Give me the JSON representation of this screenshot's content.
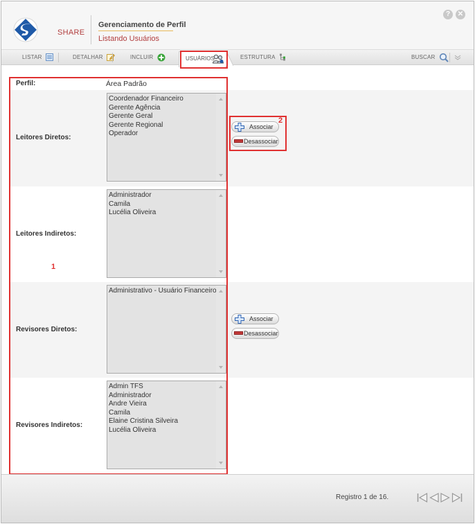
{
  "header": {
    "brand": "SHARE",
    "title": "Gerenciamento de Perfil",
    "subtitle": "Listando Usuários",
    "help_glyph": "?",
    "close_glyph": "✕"
  },
  "toolbar": {
    "listar": "LISTAR",
    "detalhar": "DETALHAR",
    "incluir": "INCLUIR",
    "usuarios": "USUÁRIOS",
    "estrutura": "ESTRUTURA",
    "buscar": "BUSCAR"
  },
  "form": {
    "perfil_label": "Perfil:",
    "perfil_value": "Área Padrão",
    "leitores_diretos": {
      "label": "Leitores Diretos:",
      "items": [
        "Coordenador Financeiro",
        "Gerente Agência",
        "Gerente Geral",
        "Gerente Regional",
        "Operador"
      ]
    },
    "leitores_indiretos": {
      "label": "Leitores Indiretos:",
      "items": [
        "Administrador",
        "Camila",
        "Lucélia Oliveira"
      ]
    },
    "revisores_diretos": {
      "label": "Revisores Diretos:",
      "items": [
        "Administrativo - Usuário Financeiro"
      ]
    },
    "revisores_indiretos": {
      "label": "Revisores Indiretos:",
      "items": [
        "Admin TFS",
        "Administrador",
        "Andre Vieira",
        "Camila",
        "Elaine Cristina Silveira",
        "Lucélia Oliveira"
      ]
    }
  },
  "buttons": {
    "associar": "Associar",
    "desassociar": "Desassociar"
  },
  "annotations": {
    "box1": "1",
    "box2": "2",
    "color": "#e03030"
  },
  "footer": {
    "registro": "Registro 1 de 16."
  },
  "colors": {
    "brand_red": "#b23e3e",
    "brand_blue": "#1f5aa8",
    "accent_green": "#3aa53a"
  }
}
